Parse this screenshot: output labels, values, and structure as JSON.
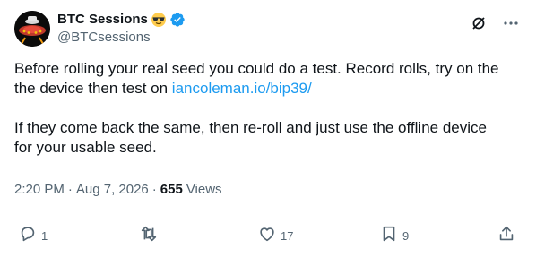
{
  "author": {
    "display_name": "BTC Sessions",
    "name_emoji": "sunglasses-emoji",
    "verified_badge": "verified-badge-icon",
    "handle": "@BTCsessions"
  },
  "top_actions": {
    "grok_icon": "grok-icon",
    "more_icon": "more-icon"
  },
  "tweet": {
    "line1": "Before rolling your real seed you could do a test. Record rolls, try on the",
    "line2_prefix": "the device then test on ",
    "link_text": "iancoleman.io/bip39/",
    "para2_line1": "If they come back the same, then re-roll and just use the offline device",
    "para2_line2": "for your usable seed."
  },
  "meta": {
    "time": "2:20 PM",
    "dot1": "·",
    "date": "Aug 7, 2026",
    "dot2": "·",
    "views_count": "655",
    "views_label": "Views"
  },
  "actions": {
    "reply_count": "1",
    "repost_count": "",
    "like_count": "17",
    "bookmark_count": "9"
  },
  "colors": {
    "text": "#0f1419",
    "secondary": "#536471",
    "link": "#1d9bf0",
    "verified": "#1d9bf0",
    "divider": "#eff3f4"
  }
}
